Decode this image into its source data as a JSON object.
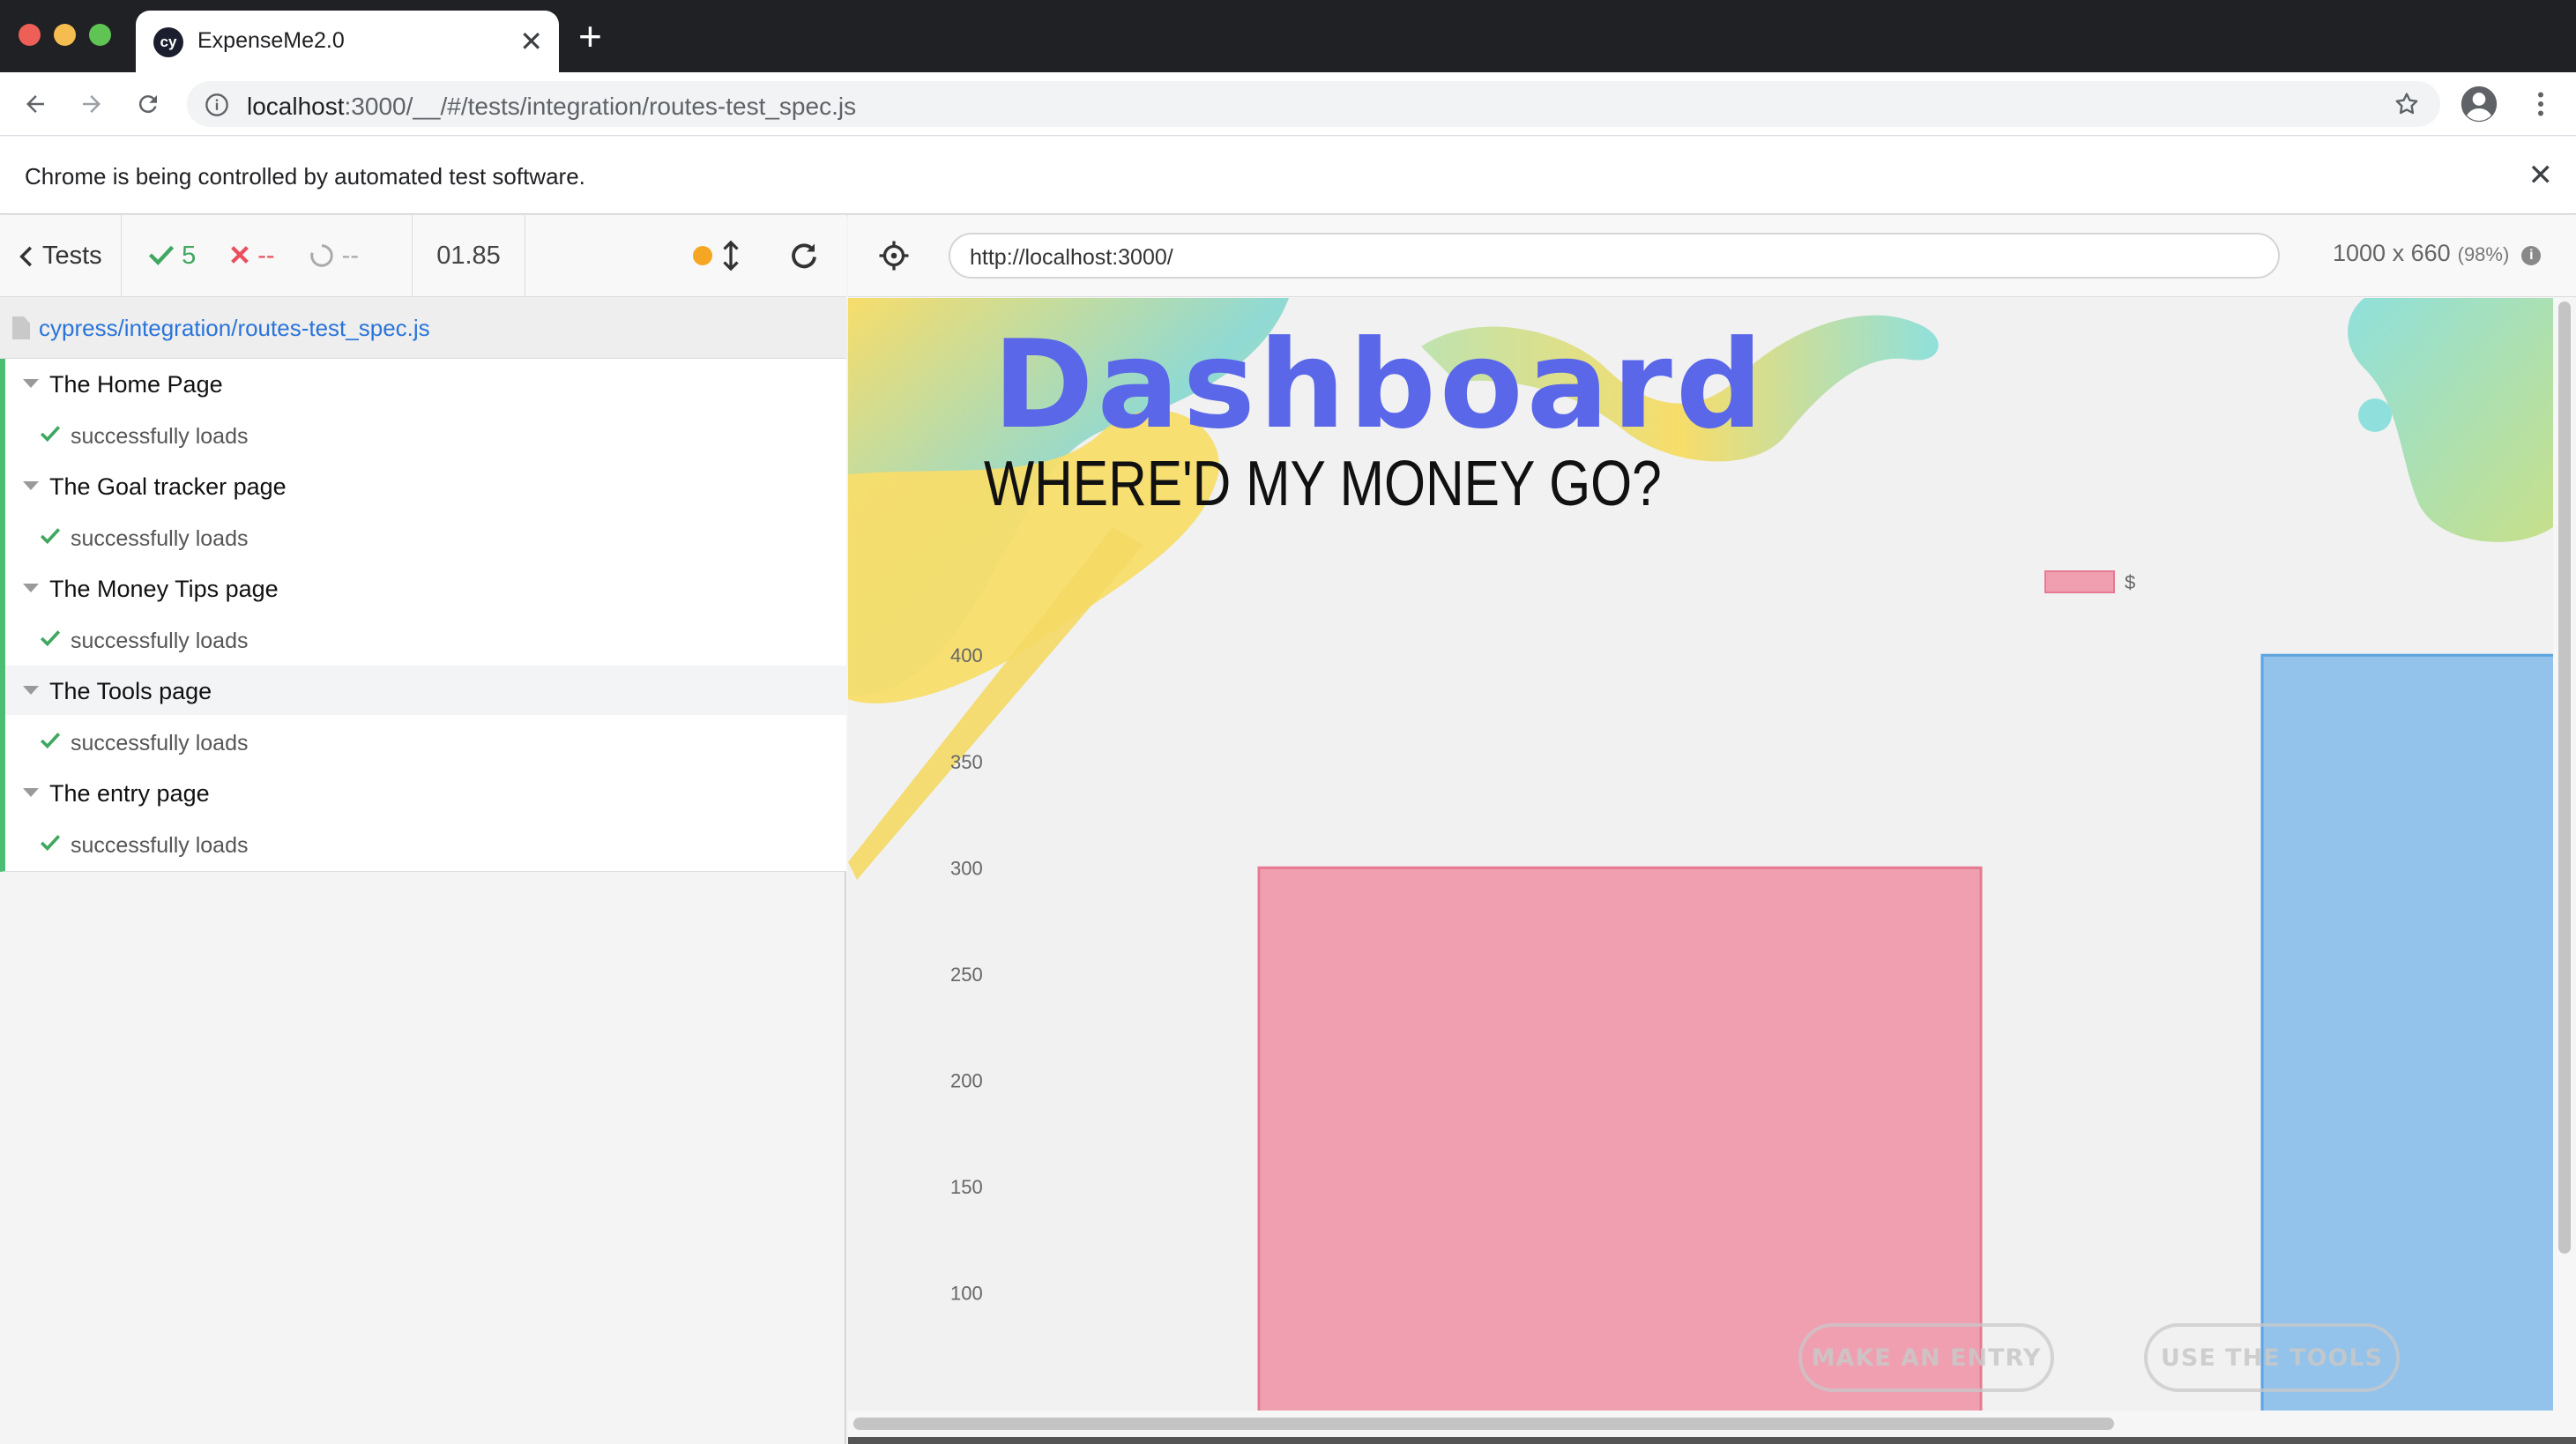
{
  "browser": {
    "tab_title": "ExpenseMe2.0",
    "tab_favicon": "cy",
    "new_tab_symbol": "+",
    "close_symbol": "✕",
    "url_host": "localhost",
    "url_path": ":3000/__/#/tests/integration/routes-test_spec.js",
    "infobar_text": "Chrome is being controlled by automated test software.",
    "icons": [
      "back-arrow-icon",
      "forward-arrow-icon",
      "reload-icon",
      "info-icon",
      "star-icon",
      "account-icon",
      "menu-dots-icon"
    ]
  },
  "reporter": {
    "tests_label": "Tests",
    "passed_count": "5",
    "failed_count": "--",
    "pending_count": "--",
    "duration": "01.85",
    "spec_path": "cypress/integration/routes-test_spec.js",
    "suites": [
      {
        "title": "The Home Page",
        "test": "successfully loads"
      },
      {
        "title": "The Goal tracker page",
        "test": "successfully loads"
      },
      {
        "title": "The Money Tips page",
        "test": "successfully loads"
      },
      {
        "title": "The Tools page",
        "test": "successfully loads"
      },
      {
        "title": "The entry page",
        "test": "successfully loads"
      }
    ],
    "colors": {
      "pass": "#3fa75f",
      "fail": "#e94f5f",
      "running_dot": "#f5a623",
      "accent_border": "#4dbd74",
      "link": "#2a74d9"
    }
  },
  "aut": {
    "url": "http://localhost:3000/",
    "viewport_size": "1000 x 660",
    "viewport_scale": "(98%)",
    "info_symbol": "i"
  },
  "app": {
    "title": "Dashboard",
    "subtitle": "WHERE'D MY MONEY GO?",
    "make_entry_label": "MAKE AN ENTRY",
    "use_tools_label": "USE THE TOOLS",
    "title_color": "#5a67e8"
  },
  "chart_data": {
    "type": "bar",
    "series": [
      {
        "name": "$",
        "values": [
          300,
          400
        ]
      }
    ],
    "bar_colors": [
      "#f09fb1",
      "#93c2ea"
    ],
    "bar_border_colors": [
      "#e67a93",
      "#5da4e0"
    ],
    "legend": "top",
    "y_ticks": [
      400,
      350,
      300,
      250,
      200,
      150,
      100
    ],
    "ylim": [
      60,
      420
    ],
    "grid": false
  }
}
